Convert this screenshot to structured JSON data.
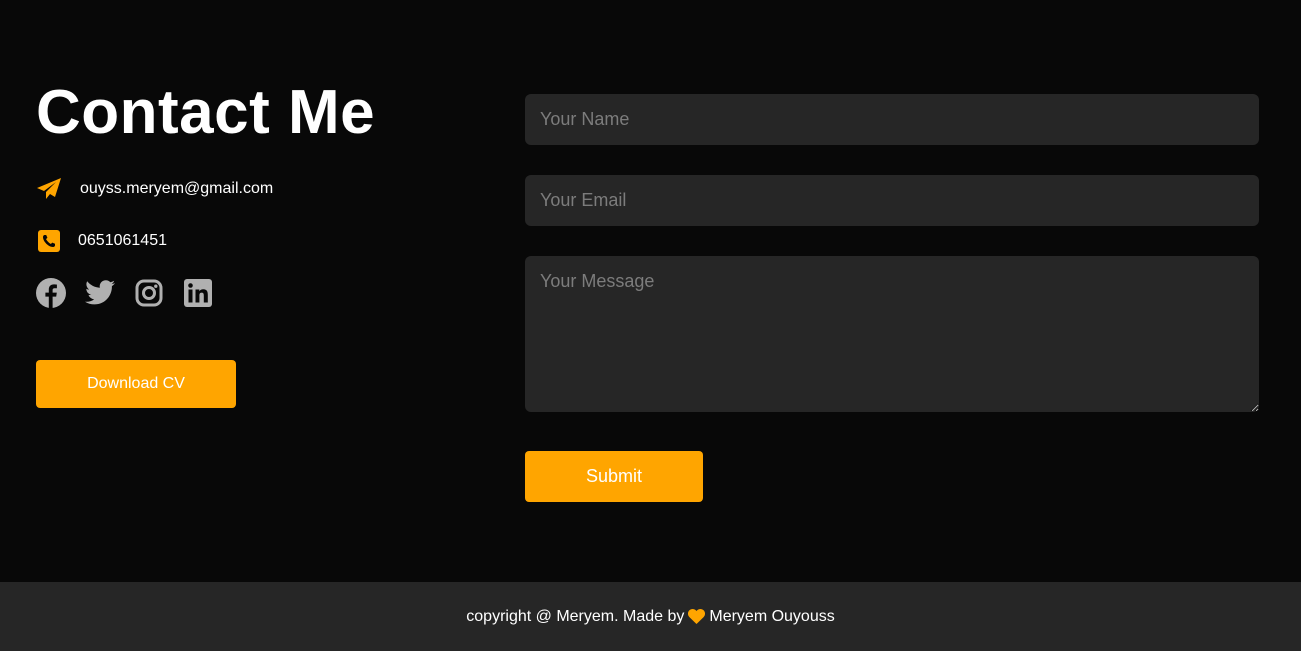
{
  "contact": {
    "title": "Contact Me",
    "email": "ouyss.meryem@gmail.com",
    "phone": "0651061451",
    "socials": [
      {
        "icon": "facebook-icon"
      },
      {
        "icon": "twitter-icon"
      },
      {
        "icon": "instagram-icon"
      },
      {
        "icon": "linkedin-icon"
      }
    ],
    "download_label": "Download CV"
  },
  "form": {
    "name_placeholder": "Your Name",
    "email_placeholder": "Your Email",
    "message_placeholder": "Your Message",
    "name_value": "",
    "email_value": "",
    "message_value": "",
    "submit_label": "Submit"
  },
  "footer": {
    "prefix": "copyright @ Meryem. Made by",
    "author": "Meryem Ouyouss"
  },
  "colors": {
    "background": "#080808",
    "panel": "#262626",
    "accent": "#ffa500",
    "icon_gray": "#b0b0b0"
  }
}
